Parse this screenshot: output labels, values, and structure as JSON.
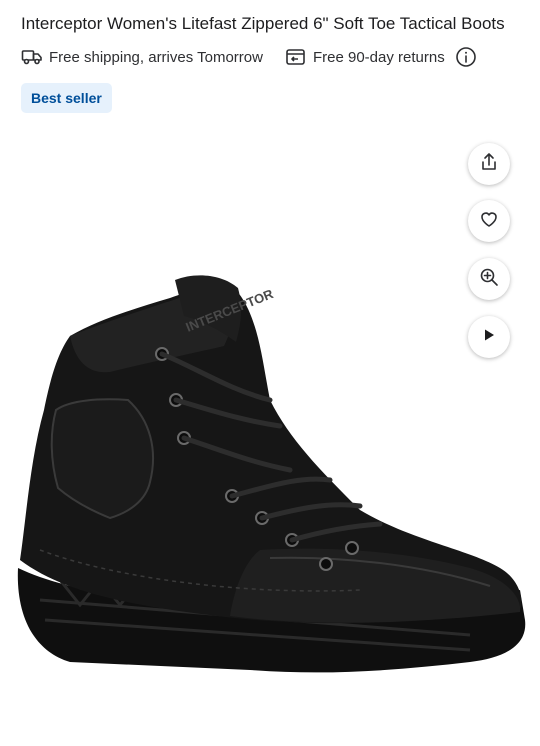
{
  "product": {
    "title": "Interceptor Women's Litefast Zippered 6\" Soft Toe Tactical Boots"
  },
  "shipping": {
    "icon": "truck-icon",
    "text": "Free shipping, arrives Tomorrow"
  },
  "returns": {
    "icon": "returns-box-icon",
    "text": "Free 90-day returns"
  },
  "badge": {
    "label": "Best seller",
    "bg": "#e6f1fc",
    "color": "#004f9a"
  },
  "image": {
    "boot_color": "#151515",
    "brand_stamp": "INTERCEPTOR"
  },
  "actions": [
    {
      "icon": "share-icon"
    },
    {
      "icon": "heart-icon"
    },
    {
      "icon": "zoom-in-icon"
    },
    {
      "icon": "play-icon"
    }
  ]
}
